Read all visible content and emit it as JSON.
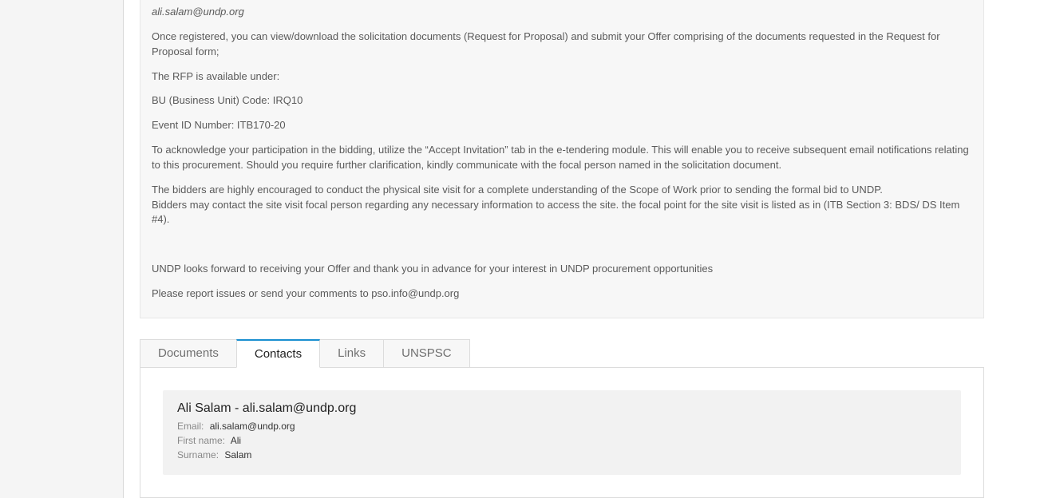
{
  "description": {
    "email_truncated": "ali.salam@undp.org",
    "p1": "Once registered, you can view/download the solicitation documents (Request for Proposal) and submit your Offer comprising of the documents requested in the Request for Proposal form;",
    "p2": "The RFP is available under:",
    "p3": "BU (Business Unit) Code: IRQ10",
    "p4": "Event ID Number: ITB170-20",
    "p5": "To acknowledge your participation in the bidding, utilize the “Accept Invitation” tab in the e-tendering module. This will enable you to receive subsequent email notifications relating to this procurement. Should you require further clarification, kindly communicate with the focal person named in the solicitation document.",
    "p6a": "The bidders are highly encouraged to conduct the physical site visit for a complete understanding of the Scope of Work prior to sending the formal bid to UNDP.",
    "p6b": "Bidders may contact the site visit focal person regarding any necessary information to access the site. the focal point for the site visit is listed as in (ITB Section 3: BDS/ DS Item #4).",
    "p7": "UNDP looks forward to receiving your Offer and thank you in advance for your interest in UNDP procurement opportunities",
    "p8": "Please report issues or send your comments to pso.info@undp.org"
  },
  "tabs": {
    "documents": "Documents",
    "contacts": "Contacts",
    "links": "Links",
    "unspsc": "UNSPSC"
  },
  "contact": {
    "title": "Ali Salam - ali.salam@undp.org",
    "email_label": "Email:",
    "email_value": "ali.salam@undp.org",
    "first_label": "First name:",
    "first_value": "Ali",
    "surname_label": "Surname:",
    "surname_value": "Salam"
  }
}
